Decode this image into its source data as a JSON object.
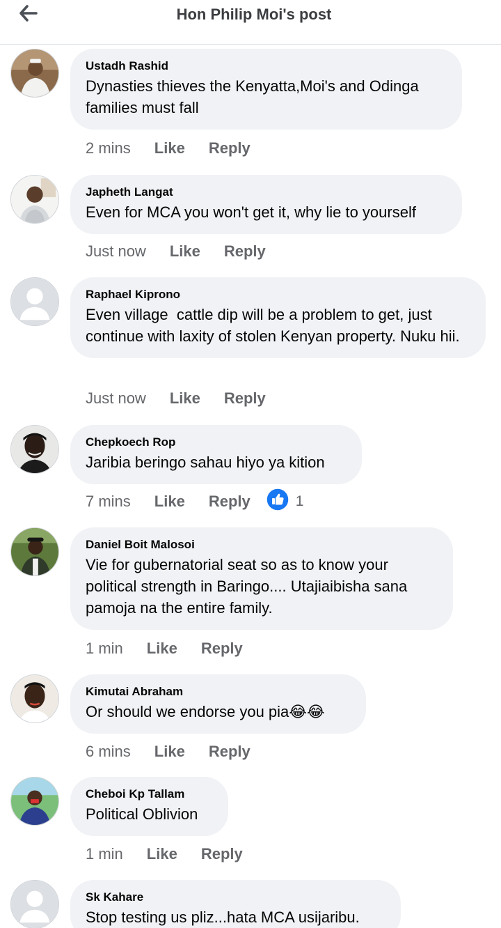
{
  "header": {
    "title": "Hon Philip Moi's post"
  },
  "comments": [
    {
      "author": "Ustadh Rashid",
      "text": "Dynasties thieves the Kenyatta,Moi's and Odinga families must fall",
      "time": "2 mins",
      "like": "Like",
      "reply": "Reply"
    },
    {
      "author": "Japheth Langat",
      "text": "Even for MCA you won't get it, why lie to yourself",
      "time": "Just now",
      "like": "Like",
      "reply": "Reply"
    },
    {
      "author": "Raphael Kiprono",
      "text": "Even village  cattle dip will be a problem to get, just continue with laxity of stolen Kenyan property. Nuku hii.",
      "time": "Just now",
      "like": "Like",
      "reply": "Reply"
    },
    {
      "author": "Chepkoech Rop",
      "text": "Jaribia beringo sahau hiyo ya kition",
      "time": "7 mins",
      "like": "Like",
      "reply": "Reply",
      "reaction_count": "1",
      "reaction_icon": "thumbs-up-icon"
    },
    {
      "author": "Daniel Boit Malosoi",
      "text": "Vie for gubernatorial seat so as to know your political strength in Baringo.... Utajiaibisha sana pamoja na the entire family.",
      "time": "1 min",
      "like": "Like",
      "reply": "Reply"
    },
    {
      "author": "Kimutai Abraham",
      "text": "Or should we endorse you pia😂😂",
      "time": "6 mins",
      "like": "Like",
      "reply": "Reply"
    },
    {
      "author": "Cheboi Kp Tallam",
      "text": "Political Oblivion",
      "time": "1 min",
      "like": "Like",
      "reply": "Reply"
    },
    {
      "author": "Sk Kahare",
      "text": "Stop testing us pliz...hata MCA usijaribu.",
      "time": "",
      "like": "",
      "reply": ""
    }
  ],
  "colors": {
    "bubble": "#f0f2f5",
    "secondary_text": "#65676b",
    "like_blue": "#1877f2"
  }
}
